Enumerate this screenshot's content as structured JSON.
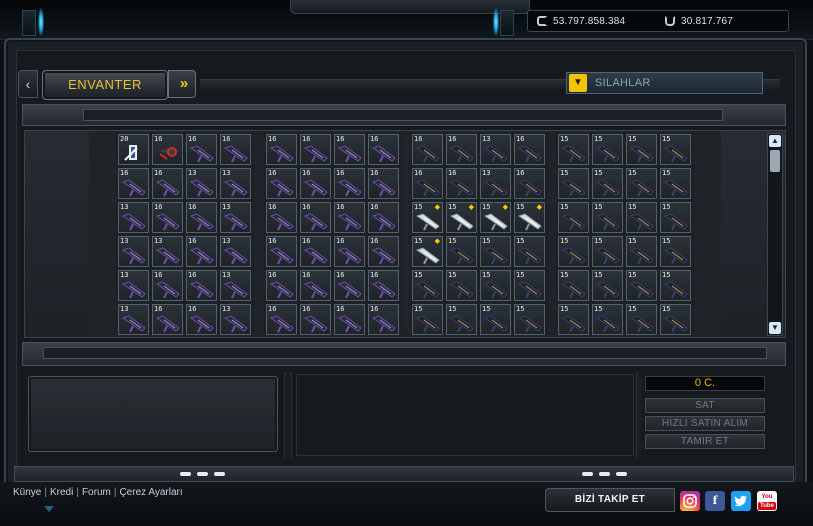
{
  "currency": {
    "cash": "53.797.858.384",
    "units": "30.817.767"
  },
  "header": {
    "tab_label": "ENVANTER",
    "next_symbol": "»",
    "prev_symbol": "‹",
    "category_label": "SILAHLAR"
  },
  "inventory": {
    "groups": [
      [
        [
          "20",
          "16",
          "16",
          "16"
        ],
        [
          "16",
          "16",
          "13",
          "13"
        ],
        [
          "13",
          "16",
          "16",
          "13"
        ],
        [
          "13",
          "13",
          "16",
          "13"
        ],
        [
          "13",
          "16",
          "16",
          "13"
        ],
        [
          "13",
          "16",
          "16",
          "13"
        ]
      ],
      [
        [
          "16",
          "16",
          "16",
          "16"
        ],
        [
          "16",
          "16",
          "16",
          "16"
        ],
        [
          "16",
          "16",
          "16",
          "16"
        ],
        [
          "16",
          "16",
          "16",
          "16"
        ],
        [
          "16",
          "16",
          "16",
          "16"
        ],
        [
          "16",
          "16",
          "16",
          "16"
        ]
      ],
      [
        [
          "16",
          "16",
          "13",
          "16"
        ],
        [
          "16",
          "16",
          "13",
          "16"
        ],
        [
          "15",
          "15",
          "15",
          "15"
        ],
        [
          "15",
          "15",
          "15",
          "15"
        ],
        [
          "15",
          "15",
          "15",
          "15"
        ],
        [
          "15",
          "15",
          "15",
          "15"
        ]
      ],
      [
        [
          "15",
          "15",
          "15",
          "15"
        ],
        [
          "15",
          "15",
          "15",
          "15"
        ],
        [
          "15",
          "15",
          "15",
          "15"
        ],
        [
          "15",
          "15",
          "15",
          "15"
        ],
        [
          "15",
          "15",
          "15",
          "15"
        ],
        [
          "15",
          "15",
          "15",
          "15"
        ]
      ]
    ],
    "starred_slots": [
      "2-2-0",
      "2-2-1",
      "2-2-2",
      "2-2-3",
      "2-3-0"
    ],
    "silver_slots": [
      "2-2-0",
      "2-2-1",
      "2-2-2",
      "2-2-3",
      "2-3-0"
    ],
    "special_slots": [
      "0-0-0",
      "0-0-1"
    ]
  },
  "actions": {
    "price": "0 C.",
    "sell": "SAT",
    "quick_buy": "HIZLI SATIN ALIM",
    "repair": "TAMIR ET"
  },
  "footer": {
    "links": [
      "Künye",
      "Kredi",
      "Forum",
      "Çerez Ayarları"
    ],
    "separator": "|",
    "follow_label": "BİZİ TAKİP ET",
    "social": {
      "facebook": "f",
      "youtube_top": "You",
      "youtube_bottom": "Tube"
    }
  },
  "colors": {
    "tab_text": "#e8c23a",
    "price_text": "#f1b500",
    "accent_glow": "#19a6d8"
  },
  "icons": {
    "scroll_up": "▲",
    "scroll_down": "▼",
    "category_dropdown": "▼"
  }
}
